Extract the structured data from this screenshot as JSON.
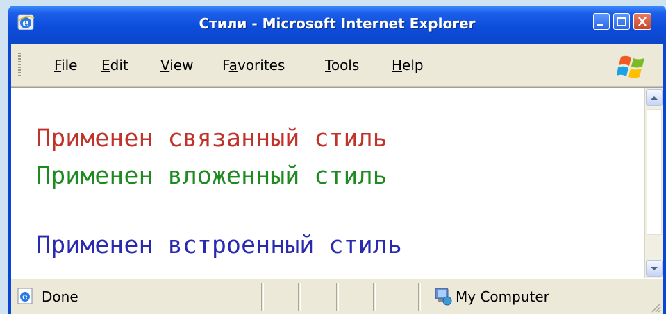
{
  "window": {
    "title": "Стили - Microsoft Internet Explorer"
  },
  "menubar": {
    "items": [
      {
        "hotkey": "F",
        "rest": "ile"
      },
      {
        "hotkey": "E",
        "rest": "dit"
      },
      {
        "hotkey": "V",
        "rest": "iew"
      },
      {
        "before": "F",
        "hotkey": "a",
        "rest": "vorites"
      },
      {
        "hotkey": "T",
        "rest": "ools"
      },
      {
        "hotkey": "H",
        "rest": "elp"
      }
    ]
  },
  "content": {
    "lines": [
      {
        "text": "Применен связанный стиль",
        "color": "#c0332a"
      },
      {
        "text": "Применен вложенный стиль",
        "color": "#1f8a22"
      },
      {
        "text": "Применен встроенный стиль",
        "color": "#2a2ab0"
      }
    ]
  },
  "status": {
    "text": "Done",
    "zone": "My Computer"
  },
  "icons": {
    "app": "ie-icon",
    "logo": "windows-logo-icon",
    "status": "ie-page-icon",
    "zone": "my-computer-icon"
  }
}
